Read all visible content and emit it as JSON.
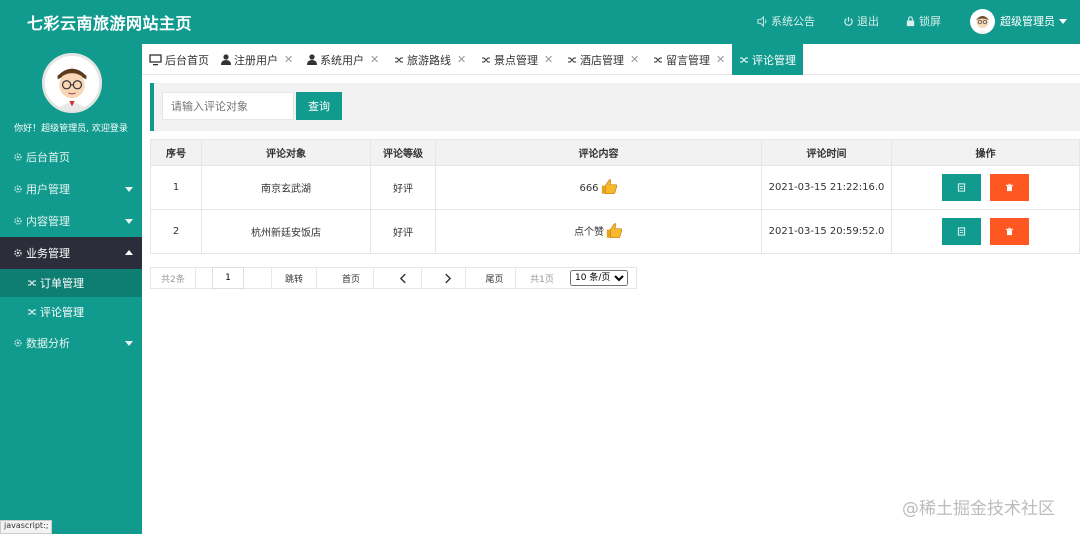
{
  "header": {
    "title": "七彩云南旅游网站主页",
    "notice": "系统公告",
    "logout": "退出",
    "lock": "锁屏",
    "admin": "超级管理员"
  },
  "sidebar": {
    "welcome": "你好！超级管理员, 欢迎登录",
    "items": [
      {
        "label": "后台首页"
      },
      {
        "label": "用户管理"
      },
      {
        "label": "内容管理"
      },
      {
        "label": "业务管理"
      },
      {
        "label": "数据分析"
      }
    ],
    "subitems": [
      {
        "label": "订单管理"
      },
      {
        "label": "评论管理"
      }
    ]
  },
  "tabs": [
    {
      "label": "后台首页"
    },
    {
      "label": "注册用户"
    },
    {
      "label": "系统用户"
    },
    {
      "label": "旅游路线"
    },
    {
      "label": "景点管理"
    },
    {
      "label": "酒店管理"
    },
    {
      "label": "留言管理"
    },
    {
      "label": "评论管理"
    }
  ],
  "toolbar": {
    "search_placeholder": "请输入评论对象",
    "search_label": "查询"
  },
  "table": {
    "headers": [
      "序号",
      "评论对象",
      "评论等级",
      "评论内容",
      "评论时间",
      "操作"
    ],
    "rows": [
      {
        "no": "1",
        "target": "南京玄武湖",
        "level": "好评",
        "content": "666",
        "time": "2021-03-15 21:22:16.0"
      },
      {
        "no": "2",
        "target": "杭州新廷安饭店",
        "level": "好评",
        "content": "点个赞",
        "time": "2021-03-15 20:59:52.0"
      }
    ]
  },
  "pager": {
    "total": "共2条",
    "page_value": "1",
    "jump": "跳转",
    "first": "首页",
    "last": "尾页",
    "pages": "共1页",
    "page_size": "10 条/页"
  },
  "status_bar": "javascript:;",
  "watermark": "@稀土掘金技术社区",
  "colors": {
    "primary": "#119b8e",
    "danger": "#ff5722",
    "dark": "#2b2e3a"
  }
}
